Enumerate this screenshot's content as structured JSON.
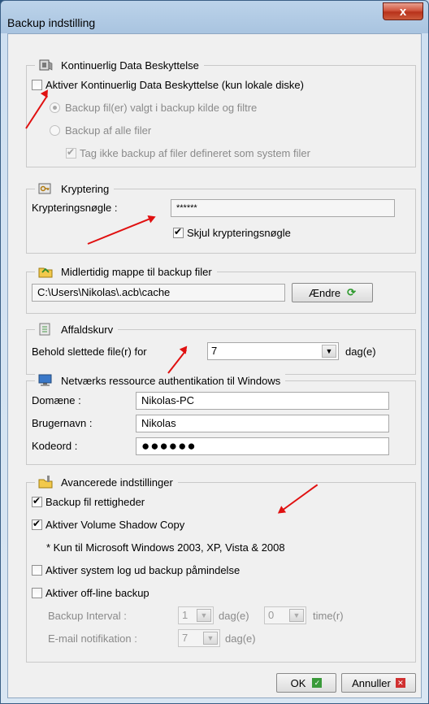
{
  "window": {
    "title": "Backup indstilling",
    "close_label": "x"
  },
  "cdp": {
    "title": "Kontinuerlig Data Beskyttelse",
    "enable_label": "Aktiver Kontinuerlig Data Beskyttelse (kun lokale diske)",
    "enabled": false,
    "radio_selected_label": "Backup fil(er) valgt i backup kilde og filtre",
    "radio_all_label": "Backup af alle filer",
    "skip_system_label": "Tag ikke backup af filer defineret som system filer",
    "skip_system_checked": true
  },
  "encryption": {
    "title": "Kryptering",
    "key_label": "Krypteringsnøgle :",
    "key_value": "******",
    "hide_key_label": "Skjul krypteringsnøgle",
    "hide_key_checked": true
  },
  "temp_folder": {
    "title": "Midlertidig mappe til backup filer",
    "path": "C:\\Users\\Nikolas\\.acb\\cache",
    "change_label": "Ændre"
  },
  "recycle": {
    "title": "Affaldskurv",
    "keep_label": "Behold slettede file(r) for",
    "keep_value": "7",
    "unit": "dag(e)"
  },
  "network": {
    "title": "Netværks ressource authentikation til Windows",
    "domain_label": "Domæne :",
    "domain_value": "Nikolas-PC",
    "user_label": "Brugernavn :",
    "user_value": "Nikolas",
    "password_label": "Kodeord :",
    "password_value": "●●●●●●"
  },
  "advanced": {
    "title": "Avancerede indstillinger",
    "backup_rights_label": "Backup fil rettigheder",
    "backup_rights_checked": true,
    "vss_label": "Aktiver Volume Shadow Copy",
    "vss_checked": true,
    "note": "* Kun til Microsoft Windows 2003, XP, Vista & 2008",
    "syslog_label": "Aktiver system log ud backup påmindelse",
    "offline_label": "Aktiver off-line backup",
    "interval_label": "Backup Interval :",
    "interval_days": "1",
    "days_unit": "dag(e)",
    "interval_hours": "0",
    "hours_unit": "time(r)",
    "email_label": "E-mail notifikation :",
    "email_days": "7",
    "email_unit": "dag(e)"
  },
  "footer": {
    "ok_label": "OK",
    "cancel_label": "Annuller"
  },
  "colors": {
    "annotation_arrow": "#e01010",
    "title_bar": "#bcd3ea",
    "close_button": "#c9432a"
  }
}
